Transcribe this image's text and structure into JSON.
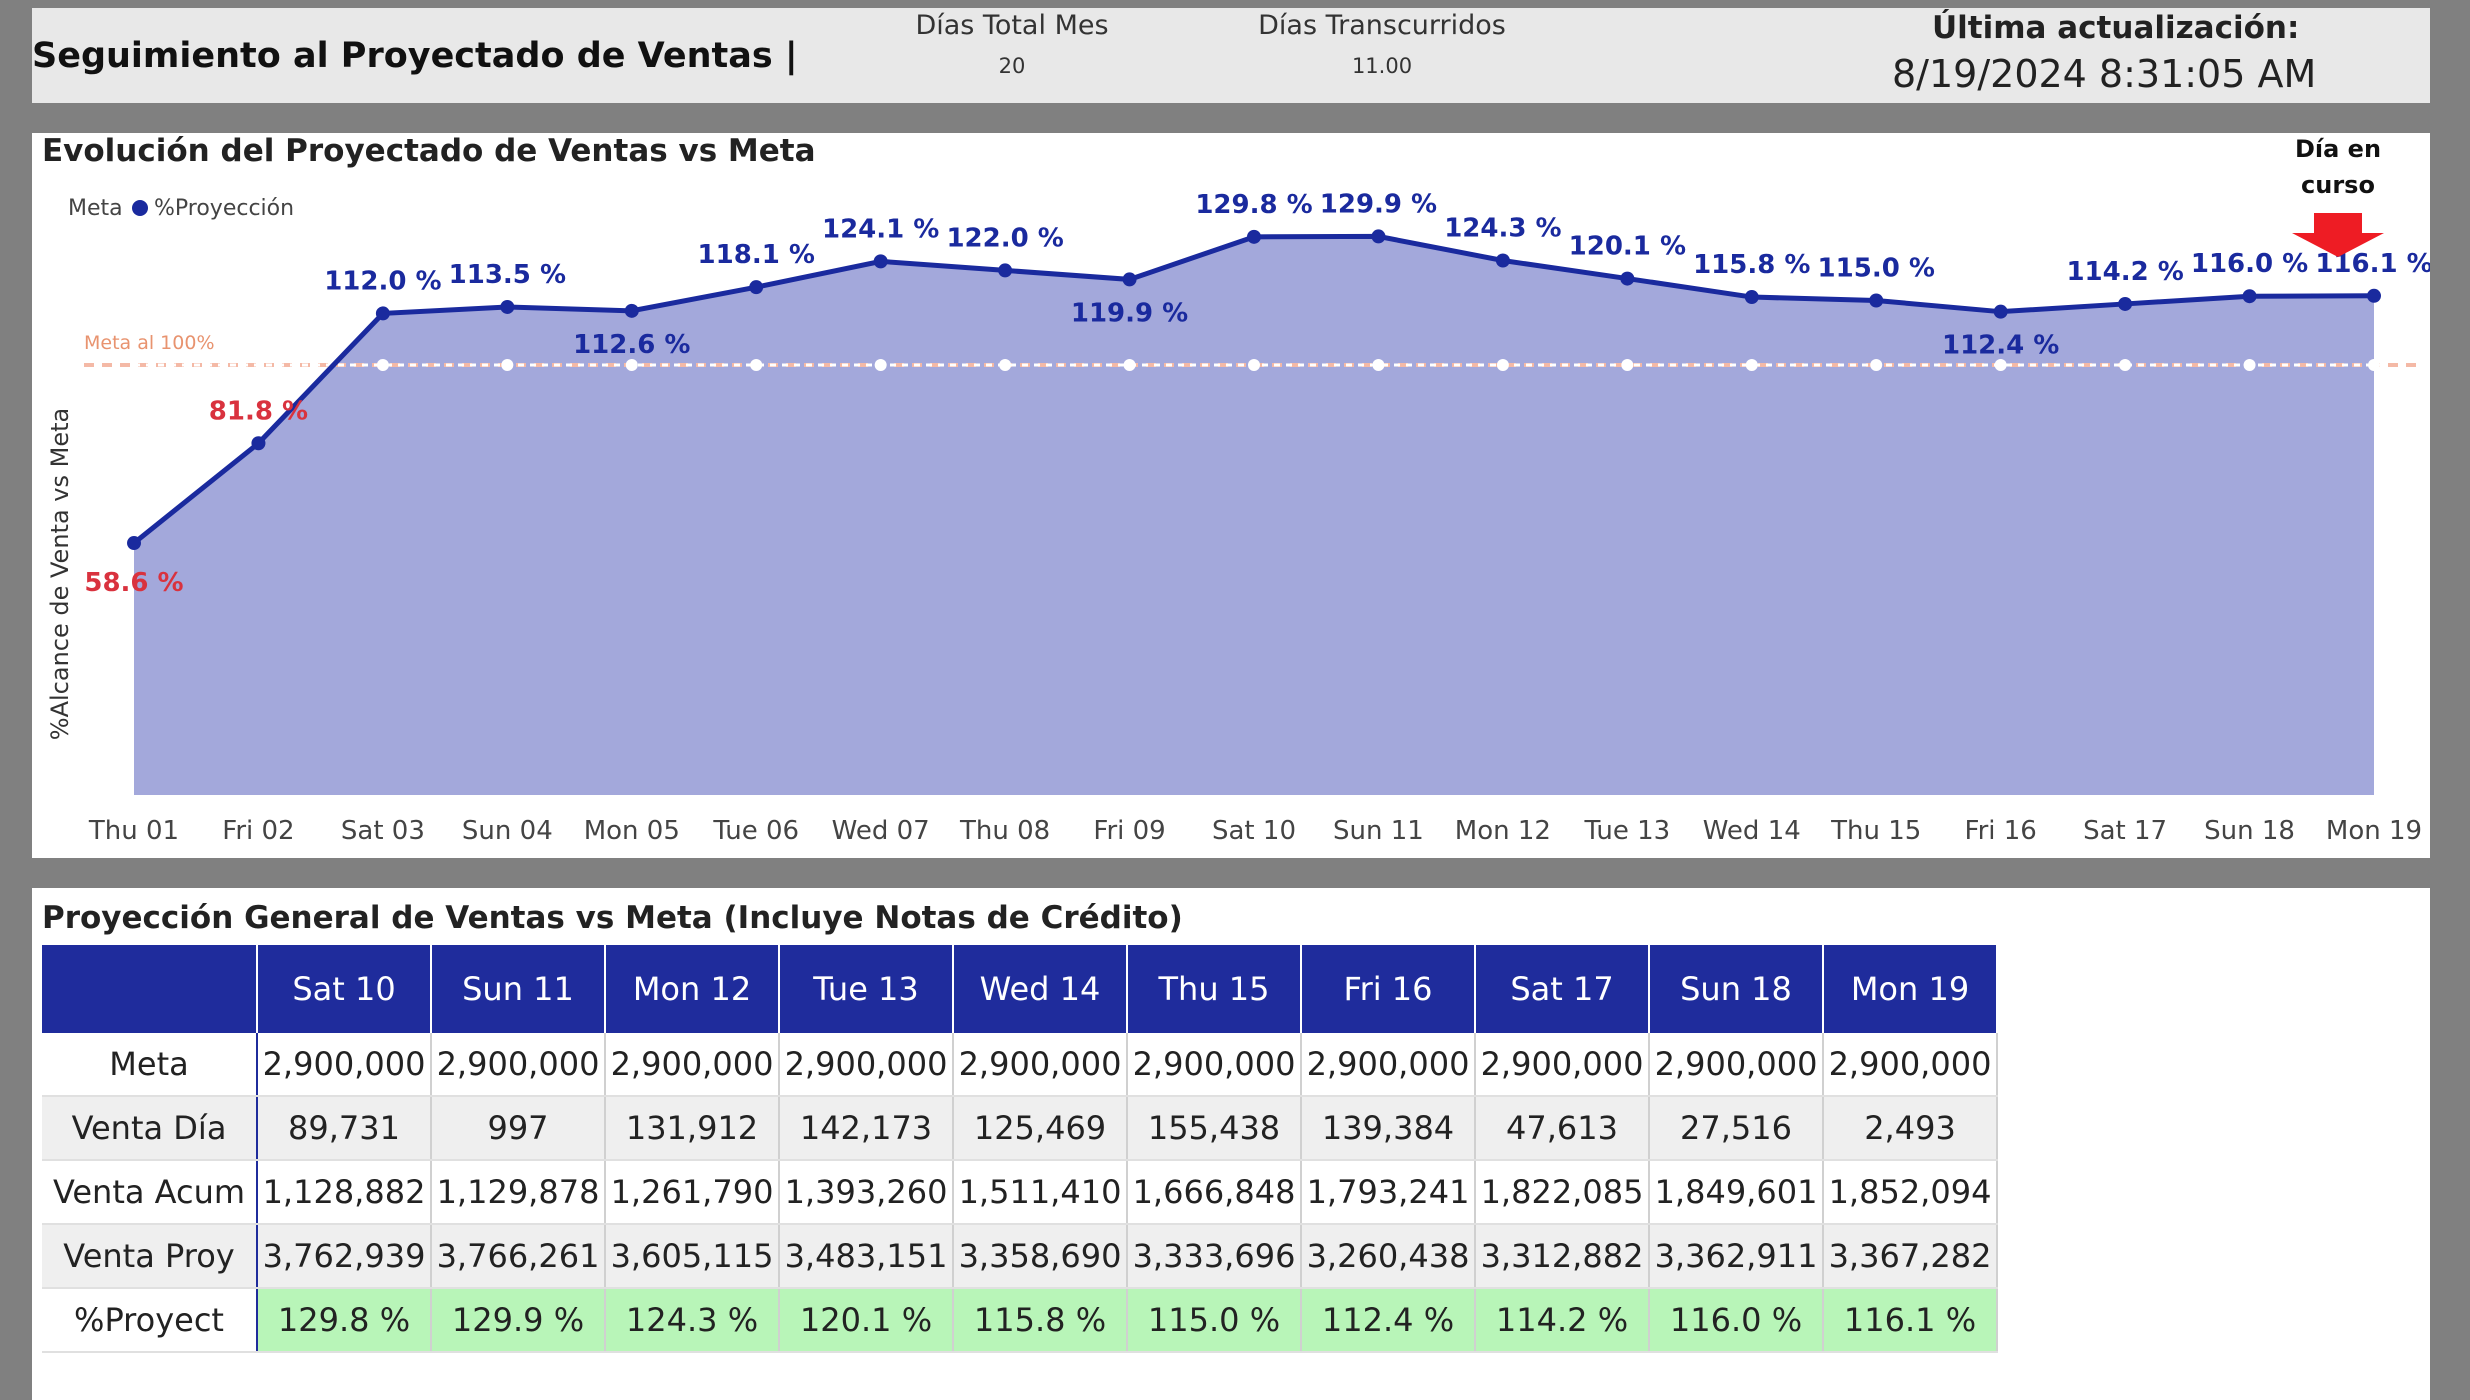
{
  "header": {
    "title": "Seguimiento al Proyectado de Ventas |",
    "dias_total_label": "Días Total Mes",
    "dias_total_value": "20",
    "dias_trans_label": "Días Transcurridos",
    "dias_trans_value": "11.00",
    "update_label": "Última actualización:",
    "update_value": "8/19/2024 8:31:05 AM"
  },
  "chart_data": {
    "type": "area",
    "title": "Evolución del Proyectado de Ventas vs Meta",
    "ylabel": "%Alcance de Venta vs Meta",
    "xlabel": "",
    "legend": {
      "placement": "top-left",
      "items": [
        "Meta",
        "%Proyección"
      ]
    },
    "categories": [
      "Thu 01",
      "Fri 02",
      "Sat 03",
      "Sun 04",
      "Mon 05",
      "Tue 06",
      "Wed 07",
      "Thu 08",
      "Fri 09",
      "Sat 10",
      "Sun 11",
      "Mon 12",
      "Tue 13",
      "Wed 14",
      "Thu 15",
      "Fri 16",
      "Sat 17",
      "Sun 18",
      "Mon 19"
    ],
    "series": [
      {
        "name": "%Proyección",
        "color": "#1a2a9e",
        "fill": "#a3a8db",
        "values": [
          58.6,
          81.8,
          112.0,
          113.5,
          112.6,
          118.1,
          124.1,
          122.0,
          119.9,
          129.8,
          129.9,
          124.3,
          120.1,
          115.8,
          115.0,
          112.4,
          114.2,
          116.0,
          116.1
        ],
        "labels": [
          "58.6 %",
          "81.8 %",
          "112.0 %",
          "113.5 %",
          "112.6 %",
          "118.1 %",
          "124.1 %",
          "122.0 %",
          "119.9 %",
          "129.8 %",
          "129.9 %",
          "124.3 %",
          "120.1 %",
          "115.8 %",
          "115.0 %",
          "112.4 %",
          "114.2 %",
          "116.0 %",
          "116.1 %"
        ]
      },
      {
        "name": "Meta",
        "color": "#ffffff",
        "values": [
          100,
          100,
          100,
          100,
          100,
          100,
          100,
          100,
          100,
          100,
          100,
          100,
          100,
          100,
          100,
          100,
          100,
          100,
          100
        ]
      }
    ],
    "reference_line": {
      "value": 100,
      "label": "Meta al 100%",
      "color": "#f4b9a6"
    },
    "below_target_color": "#d9323e",
    "ylim": [
      0,
      140
    ],
    "grid": false,
    "annotation": {
      "text_line1": "Día en",
      "text_line2": "curso",
      "target": "Mon 19",
      "arrow_color": "#ee1c24"
    }
  },
  "table": {
    "title": "Proyección General de Ventas vs Meta (Incluye Notas de Crédito)",
    "columns": [
      "Sat 10",
      "Sun 11",
      "Mon 12",
      "Tue 13",
      "Wed 14",
      "Thu 15",
      "Fri 16",
      "Sat 17",
      "Sun 18",
      "Mon 19"
    ],
    "rows": [
      {
        "label": "Meta",
        "values": [
          "2,900,000",
          "2,900,000",
          "2,900,000",
          "2,900,000",
          "2,900,000",
          "2,900,000",
          "2,900,000",
          "2,900,000",
          "2,900,000",
          "2,900,000"
        ]
      },
      {
        "label": "Venta Día",
        "values": [
          "89,731",
          "997",
          "131,912",
          "142,173",
          "125,469",
          "155,438",
          "139,384",
          "47,613",
          "27,516",
          "2,493"
        ]
      },
      {
        "label": "Venta Acum",
        "values": [
          "1,128,882",
          "1,129,878",
          "1,261,790",
          "1,393,260",
          "1,511,410",
          "1,666,848",
          "1,793,241",
          "1,822,085",
          "1,849,601",
          "1,852,094"
        ]
      },
      {
        "label": "Venta Proy",
        "values": [
          "3,762,939",
          "3,766,261",
          "3,605,115",
          "3,483,151",
          "3,358,690",
          "3,333,696",
          "3,260,438",
          "3,312,882",
          "3,362,911",
          "3,367,282"
        ]
      },
      {
        "label": "%Proyect",
        "values": [
          "129.8 %",
          "129.9 %",
          "124.3 %",
          "120.1 %",
          "115.8 %",
          "115.0 %",
          "112.4 %",
          "114.2 %",
          "116.0 %",
          "116.1 %"
        ]
      }
    ],
    "highlight_color": "#b8f5b8",
    "header_color": "#1f2c9c"
  }
}
